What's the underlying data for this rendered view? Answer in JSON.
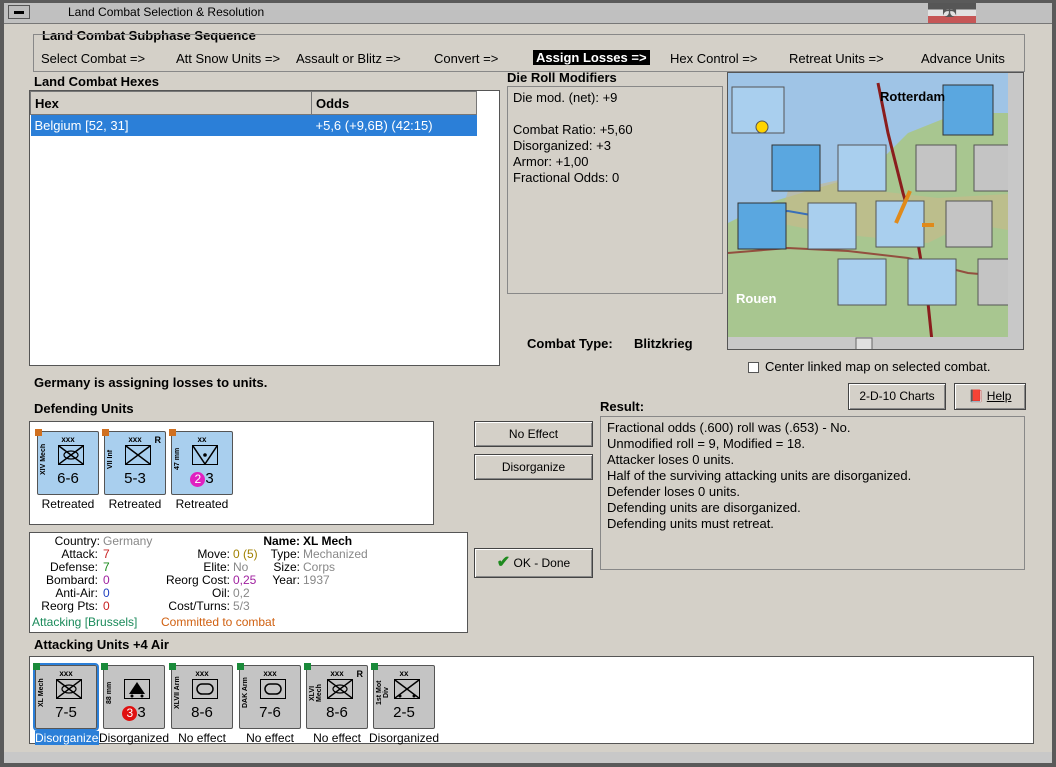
{
  "window": {
    "title": "Land Combat Selection & Resolution",
    "menu_glyph": "▬"
  },
  "sequence": {
    "title": "Land Combat Subphase Sequence",
    "steps": [
      {
        "label": "Select Combat =>",
        "active": false
      },
      {
        "label": "Att Snow Units =>",
        "active": false
      },
      {
        "label": "Assault or Blitz =>",
        "active": false
      },
      {
        "label": "Convert =>",
        "active": false
      },
      {
        "label": "Assign Losses =>",
        "active": true
      },
      {
        "label": "Hex Control =>",
        "active": false
      },
      {
        "label": "Retreat Units =>",
        "active": false
      },
      {
        "label": "Advance Units",
        "active": false
      }
    ]
  },
  "hexes": {
    "title": "Land Combat Hexes",
    "columns": [
      "Hex",
      "Odds"
    ],
    "rows": [
      {
        "hex": "Belgium [52, 31]",
        "odds": "+5,6 (+9,6B) (42:15)"
      }
    ]
  },
  "die_roll": {
    "title": "Die Roll Modifiers",
    "lines": [
      "Die mod. (net): +9",
      "",
      "Combat Ratio: +5,60",
      "Disorganized: +3",
      "Armor: +1,00",
      "Fractional Odds: 0"
    ]
  },
  "combat_type": {
    "label": "Combat Type:",
    "value": "Blitzkrieg"
  },
  "map": {
    "cities": [
      "Rotterdam",
      "Rouen"
    ],
    "center_label": "Center linked map on selected combat.",
    "center_checked": false
  },
  "status_message": "Germany is assigning losses to units.",
  "defending": {
    "title": "Defending Units",
    "units": [
      {
        "top": "xxx",
        "side": "XIV Mech",
        "value": "6-6",
        "status": "Retreated",
        "symbol": "mech",
        "r": ""
      },
      {
        "top": "xxx",
        "side": "VII Inf",
        "value": "5-3",
        "status": "Retreated",
        "symbol": "inf",
        "r": "R"
      },
      {
        "top": "xx",
        "side": "47 mm",
        "value": "3",
        "badge": "2",
        "status": "Retreated",
        "symbol": "at",
        "r": ""
      }
    ]
  },
  "buttons": {
    "no_effect": "No Effect",
    "disorganize": "Disorganize",
    "ok_done": "OK - Done",
    "charts": "2-D-10 Charts",
    "help": "Help"
  },
  "result": {
    "title": "Result:",
    "lines": [
      "Fractional odds (.600) roll was (.653)  - No.",
      "Unmodified roll = 9, Modified = 18.",
      "Attacker loses 0 units.",
      "Half of the surviving attacking units are disorganized.",
      "Defender loses 0 units.",
      "Defending units are disorganized.",
      "Defending units must retreat."
    ]
  },
  "unit_info": {
    "country_label": "Country:",
    "country": "Germany",
    "attack_label": "Attack:",
    "attack": "7",
    "defense_label": "Defense:",
    "defense": "7",
    "bombard_label": "Bombard:",
    "bombard": "0",
    "antiair_label": "Anti-Air:",
    "antiair": "0",
    "reorg_pts_label": "Reorg Pts:",
    "reorg_pts": "0",
    "name_label": "Name:",
    "name": "XL Mech",
    "move_label": "Move:",
    "move": "0 (5)",
    "type_label": "Type:",
    "type": "Mechanized",
    "elite_label": "Elite:",
    "elite": "No",
    "size_label": "Size:",
    "size": "Corps",
    "reorg_cost_label": "Reorg Cost:",
    "reorg_cost": "0,25",
    "year_label": "Year:",
    "year": "1937",
    "oil_label": "Oil:",
    "oil": "0,2",
    "cost_label": "Cost/Turns:",
    "cost": "5/3",
    "attacking": "Attacking [Brussels]",
    "committed": "Committed to combat"
  },
  "attacking": {
    "title": "Attacking Units +4 Air",
    "units": [
      {
        "top": "xxx",
        "side": "XL Mech",
        "value": "7-5",
        "status": "Disorganized",
        "symbol": "mech",
        "r": "",
        "selected": true
      },
      {
        "top": "",
        "side": "88 mm",
        "value": "3",
        "badge": "3",
        "status": "Disorganized",
        "symbol": "flak",
        "r": ""
      },
      {
        "top": "xxx",
        "side": "XLVII Arm",
        "value": "8-6",
        "status": "No effect",
        "symbol": "arm",
        "r": ""
      },
      {
        "top": "xxx",
        "side": "DAK Arm",
        "value": "7-6",
        "status": "No effect",
        "symbol": "arm",
        "r": ""
      },
      {
        "top": "xxx",
        "side": "XLVI Mech",
        "value": "8-6",
        "status": "No effect",
        "symbol": "mech",
        "r": "R"
      },
      {
        "top": "xx",
        "side": "1st Mot Div",
        "value": "2-5",
        "status": "Disorganized",
        "symbol": "mot",
        "r": ""
      }
    ]
  },
  "colors": {
    "accent": "#2b7fd8",
    "defender_unit": "#a9cfee",
    "attacker_unit": "#c4c4c4"
  }
}
